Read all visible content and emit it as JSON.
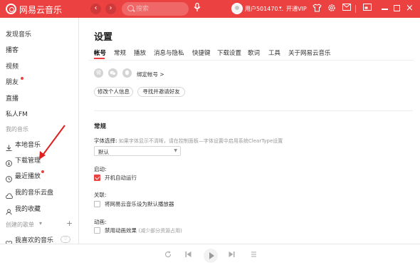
{
  "header": {
    "app_title": "网易云音乐",
    "back_glyph": "‹",
    "forward_glyph": "›",
    "search_placeholder": "搜索",
    "username": "用户501470...",
    "vip_label": "开通VIP",
    "icons": [
      "microphone-icon",
      "tshirt-icon",
      "gear-icon",
      "mail-icon",
      "miniplayer-icon",
      "minimize-icon",
      "maximize-icon",
      "close-icon"
    ],
    "accent": "#ec4141"
  },
  "sidebar": {
    "items": [
      {
        "label": "发现音乐"
      },
      {
        "label": "播客"
      },
      {
        "label": "视频"
      },
      {
        "label": "朋友"
      },
      {
        "label": "直播"
      },
      {
        "label": "私人FM"
      }
    ],
    "my_music_title": "我的音乐",
    "my_music": [
      {
        "label": "本地音乐",
        "icon": "download-icon"
      },
      {
        "label": "下载管理",
        "icon": "download-manage-icon"
      },
      {
        "label": "最近播放",
        "icon": "clock-icon"
      },
      {
        "label": "我的音乐云盘",
        "icon": "cloud-icon"
      },
      {
        "label": "我的收藏",
        "icon": "collection-icon"
      }
    ],
    "created_title": "创建的歌单",
    "liked_playlist": "我喜欢的音乐"
  },
  "main": {
    "title": "设置",
    "tabs": [
      "帐号",
      "常规",
      "播放",
      "消息与隐私",
      "快捷键",
      "下载设置",
      "歌词",
      "工具",
      "关于网易云音乐"
    ],
    "active_tab": "帐号",
    "bind_account_label": "绑定帐号 >",
    "edit_profile_button": "修改个人信息",
    "find_friends_button": "寻找并邀请好友",
    "general_title": "常规",
    "font_label": "字体选择:",
    "font_hint": "如果字体显示不清晰，请在控制面板—字体设置中启用系统ClearType设置",
    "font_value": "默认",
    "startup_label": "启动:",
    "startup_option": "开机自动运行",
    "startup_checked": true,
    "assoc_label": "关联:",
    "assoc_option": "将网易云音乐设为默认播放器",
    "assoc_checked": false,
    "animation_label": "动画:",
    "animation_option": "禁用动画效果",
    "animation_hint": "(减少部分资源占用)",
    "animation_checked": false
  }
}
